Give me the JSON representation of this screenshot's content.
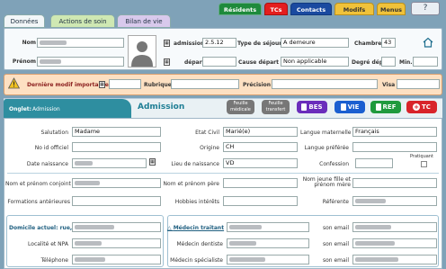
{
  "top_tabs": [
    {
      "label": "Résidents",
      "color": "#1e8a3c"
    },
    {
      "label": "TCs",
      "color": "#e41e1e"
    },
    {
      "label": "Contacts",
      "color": "#1a4aa0"
    },
    {
      "label": "Modifs",
      "color": "#f0c23a"
    },
    {
      "label": "Menus",
      "color": "#f0c23a"
    }
  ],
  "sub_tabs": [
    "Données",
    "Actions de soin",
    "Bilan de vie"
  ],
  "identity": {
    "nom_label": "Nom",
    "prenom_label": "Prénom",
    "admission_label": "admission",
    "admission_value": "2.5.12",
    "depart_label": "départ",
    "depart_value": "",
    "type_sejour_label": "Type de séjour",
    "type_sejour_value": "A demeure",
    "cause_depart_label": "Cause départ",
    "cause_depart_value": "Non applicable",
    "chambre_label": "Chambre",
    "chambre_value": "43",
    "degre_dep_label": "Degré dép",
    "min_label": "Min."
  },
  "alert": {
    "derniere_modif_label": "Dernière modif importante",
    "rubrique_label": "Rubrique",
    "precision_label": "Précision",
    "visa_label": "Visa"
  },
  "onglet": {
    "label": "Onglet:",
    "value": "Admission",
    "title": "Admission"
  },
  "buttons": {
    "feuille_medicale": "Feuille médicale",
    "feuille_transfert": "Feuille transfert",
    "bes": "BES",
    "vie": "VIE",
    "ref": "REF",
    "tc": "TC"
  },
  "form": {
    "salutation_label": "Salutation",
    "salutation_value": "Madame",
    "etat_civil_label": "Etat Civil",
    "etat_civil_value": "Marié(e)",
    "langue_maternelle_label": "Langue maternelle",
    "langue_maternelle_value": "Français",
    "no_id_label": "No id officiel",
    "origine_label": "Origine",
    "origine_value": "CH",
    "langue_preferee_label": "Langue préférée",
    "date_naissance_label": "Date naissance",
    "lieu_naissance_label": "Lieu de naissance",
    "lieu_naissance_value": "VD",
    "confession_label": "Confession",
    "pratiquant_label": "Pratiquant",
    "conjoint_label": "Nom et prénom conjoint",
    "pere_label": "Nom et prénom père",
    "mere_label": "Nom jeune fille et prénom mère",
    "formations_label": "Formations antérieures",
    "hobbies_label": "Hobbies intérêts",
    "referente_label": "Référente"
  },
  "contact": {
    "domicile_label": "Domicile actuel: rue, no",
    "localite_label": "Localité et NPA",
    "telephone_label": "Téléphone",
    "medecin_traitant_label": "Médecin traitant",
    "medecin_dentiste_label": "Médecin dentiste",
    "medecin_specialiste_label": "Médecin spécialiste",
    "son_email_label": "son email"
  }
}
